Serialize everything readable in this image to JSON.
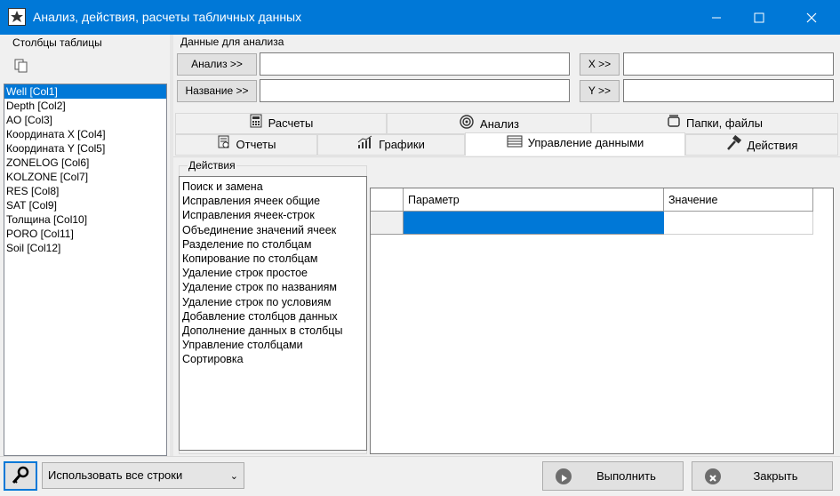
{
  "window": {
    "title": "Анализ, действия, расчеты табличных данных"
  },
  "columns_panel": {
    "title": "Столбцы таблицы",
    "items": [
      "Well [Col1]",
      "Depth [Col2]",
      "AO [Col3]",
      "Координата X [Col4]",
      "Координата Y [Col5]",
      "ZONELOG [Col6]",
      "KOLZONE [Col7]",
      "RES [Col8]",
      "SAT [Col9]",
      "Толщина [Col10]",
      "PORO [Col11]",
      "Soil [Col12]"
    ],
    "selected_index": 0
  },
  "analysis_data": {
    "title": "Данные для анализа",
    "analysis_btn": "Анализ >>",
    "name_btn": "Название >>",
    "x_btn": "X >>",
    "y_btn": "Y >>",
    "analysis_value": "",
    "name_value": "",
    "x_value": "",
    "y_value": ""
  },
  "tabs": {
    "row1": [
      "Расчеты",
      "Анализ",
      "Папки, файлы"
    ],
    "row2": [
      "Отчеты",
      "Графики",
      "Управление данными",
      "Действия"
    ],
    "active": "Управление данными"
  },
  "actions": {
    "title": "Действия",
    "items": [
      "Поиск и замена",
      "Исправления ячеек общие",
      "Исправления ячеек-строк",
      "Объединение значений ячеек",
      "Разделение по столбцам",
      "Копирование по столбцам",
      "Удаление строк простое",
      "Удаление строк по названиям",
      "Удаление строк по условиям",
      "Добавление столбцов данных",
      "Дополнение данных в столбцы",
      "Управление столбцами",
      "Сортировка"
    ]
  },
  "param_grid": {
    "headers": [
      "Параметр",
      "Значение"
    ],
    "rows": [
      [
        "",
        ""
      ]
    ]
  },
  "bottom": {
    "rows_mode": "Использовать все строки",
    "run_btn": "Выполнить",
    "close_btn": "Закрыть"
  },
  "colors": {
    "accent": "#0078d7"
  }
}
